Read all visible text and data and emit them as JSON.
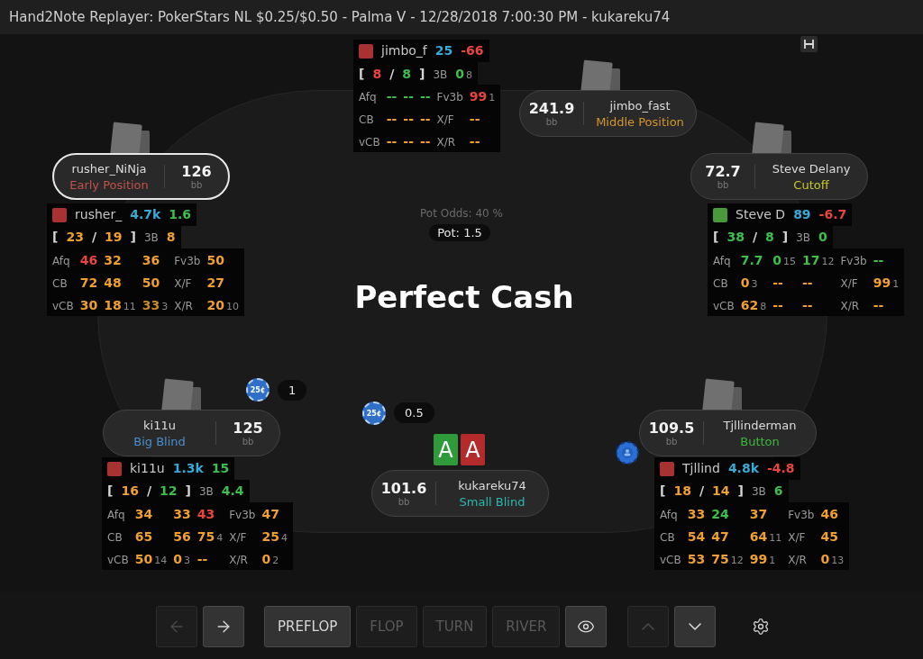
{
  "window": {
    "title": "Hand2Note Replayer: PokerStars NL $0.25/$0.50 - Palma V - 12/28/2018 7:00:30 PM - kukareku74"
  },
  "seats": [
    {
      "name": "jimbo_fast",
      "position": "Middle Position",
      "color": "#d4962c",
      "stack": "241.9",
      "unit": "bb",
      "active": false,
      "dealer": false,
      "hud": {
        "color": "#a83232",
        "header": [
          {
            "text": "jimbo_f",
            "kind": "name"
          },
          {
            "text": "25",
            "kind": "value",
            "color": "#3aa9d6"
          },
          {
            "text": "-66",
            "kind": "value",
            "color": "#e8463c"
          }
        ],
        "preflop": [
          {
            "text": "[",
            "kind": "bracket"
          },
          {
            "text": "8",
            "kind": "value",
            "color": "#e8463c"
          },
          {
            "text": "/",
            "kind": "bracket"
          },
          {
            "text": "8",
            "kind": "value",
            "color": "#3cc04a"
          },
          {
            "text": "]",
            "kind": "bracket"
          },
          {
            "text": "3B",
            "kind": "label"
          },
          {
            "text": "0",
            "kind": "value",
            "color": "#3cc04a",
            "sub": "8"
          }
        ],
        "rows": [
          [
            {
              "text": "Afq",
              "kind": "label"
            },
            {
              "text": "--",
              "kind": "value",
              "color": "#3cc04a"
            },
            {
              "text": "--",
              "kind": "value",
              "color": "#3cc04a"
            },
            {
              "text": "--",
              "kind": "value",
              "color": "#3cc04a"
            },
            {
              "text": "Fv3b",
              "kind": "label"
            },
            {
              "text": "99",
              "kind": "value",
              "color": "#e8463c",
              "sub": "1"
            }
          ],
          [
            {
              "text": "CB",
              "kind": "label"
            },
            {
              "text": "--",
              "kind": "value",
              "color": "#f0a030"
            },
            {
              "text": "--",
              "kind": "value",
              "color": "#f0a030"
            },
            {
              "text": "--",
              "kind": "value",
              "color": "#f0a030"
            },
            {
              "text": "X/F",
              "kind": "label"
            },
            {
              "text": "--",
              "kind": "value",
              "color": "#f0a030"
            }
          ],
          [
            {
              "text": "vCB",
              "kind": "label"
            },
            {
              "text": "--",
              "kind": "value",
              "color": "#f0a030"
            },
            {
              "text": "--",
              "kind": "value",
              "color": "#f0a030"
            },
            {
              "text": "--",
              "kind": "value",
              "color": "#f0a030"
            },
            {
              "text": "X/R",
              "kind": "label"
            },
            {
              "text": "--",
              "kind": "value",
              "color": "#f0a030"
            }
          ]
        ]
      }
    },
    {
      "name": "rusher_NiNja",
      "position": "Early Position",
      "color": "#c0524a",
      "stack": "126",
      "unit": "bb",
      "active": true,
      "dealer": false,
      "hud": {
        "color": "#a83232",
        "header": [
          {
            "text": "rusher_",
            "kind": "name"
          },
          {
            "text": "4.7k",
            "kind": "value",
            "color": "#3aa9d6"
          },
          {
            "text": "1.6",
            "kind": "value",
            "color": "#3cc04a"
          }
        ],
        "preflop": [
          {
            "text": "[",
            "kind": "bracket"
          },
          {
            "text": "23",
            "kind": "value",
            "color": "#f0a030"
          },
          {
            "text": "/",
            "kind": "bracket"
          },
          {
            "text": "19",
            "kind": "value",
            "color": "#f0a030"
          },
          {
            "text": "]",
            "kind": "bracket"
          },
          {
            "text": "3B",
            "kind": "label"
          },
          {
            "text": "8",
            "kind": "value",
            "color": "#f0a030"
          }
        ],
        "rows": [
          [
            {
              "text": "Afq",
              "kind": "label"
            },
            {
              "text": "46",
              "kind": "value",
              "color": "#e8463c"
            },
            {
              "text": "32",
              "kind": "value",
              "color": "#f0a030"
            },
            {
              "text": "36",
              "kind": "value",
              "color": "#f0a030"
            },
            {
              "text": "Fv3b",
              "kind": "label"
            },
            {
              "text": "50",
              "kind": "value",
              "color": "#f0a030"
            }
          ],
          [
            {
              "text": "CB",
              "kind": "label"
            },
            {
              "text": "72",
              "kind": "value",
              "color": "#f0a030"
            },
            {
              "text": "48",
              "kind": "value",
              "color": "#f0a030"
            },
            {
              "text": "50",
              "kind": "value",
              "color": "#f0a030"
            },
            {
              "text": "X/F",
              "kind": "label"
            },
            {
              "text": "27",
              "kind": "value",
              "color": "#f0a030"
            }
          ],
          [
            {
              "text": "vCB",
              "kind": "label"
            },
            {
              "text": "30",
              "kind": "value",
              "color": "#f0a030"
            },
            {
              "text": "18",
              "kind": "value",
              "color": "#f0a030",
              "sub": "11"
            },
            {
              "text": "33",
              "kind": "value",
              "color": "#c88a28",
              "sub": "3"
            },
            {
              "text": "X/R",
              "kind": "label"
            },
            {
              "text": "20",
              "kind": "value",
              "color": "#f0a030",
              "sub": "10"
            }
          ]
        ]
      }
    },
    {
      "name": "Steve Delany",
      "position": "Cutoff",
      "color": "#c8c82c",
      "stack": "72.7",
      "unit": "bb",
      "active": false,
      "dealer": false,
      "hud": {
        "color": "#4a9a3a",
        "header": [
          {
            "text": "Steve D",
            "kind": "name"
          },
          {
            "text": "89",
            "kind": "value",
            "color": "#3aa9d6"
          },
          {
            "text": "-6.7",
            "kind": "value",
            "color": "#e8463c"
          }
        ],
        "preflop": [
          {
            "text": "[",
            "kind": "bracket"
          },
          {
            "text": "38",
            "kind": "value",
            "color": "#3cc04a"
          },
          {
            "text": "/",
            "kind": "bracket"
          },
          {
            "text": "8",
            "kind": "value",
            "color": "#3cc04a"
          },
          {
            "text": "]",
            "kind": "bracket"
          },
          {
            "text": "3B",
            "kind": "label"
          },
          {
            "text": "0",
            "kind": "value",
            "color": "#3cc04a"
          }
        ],
        "rows": [
          [
            {
              "text": "Afq",
              "kind": "label"
            },
            {
              "text": "7.7",
              "kind": "value",
              "color": "#3cc04a"
            },
            {
              "text": "0",
              "kind": "value",
              "color": "#3cc04a",
              "sub": "15"
            },
            {
              "text": "17",
              "kind": "value",
              "color": "#3cc04a",
              "sub": "12"
            },
            {
              "text": "Fv3b",
              "kind": "label"
            },
            {
              "text": "--",
              "kind": "value",
              "color": "#3cc04a"
            }
          ],
          [
            {
              "text": "CB",
              "kind": "label"
            },
            {
              "text": "0",
              "kind": "value",
              "color": "#f0a030",
              "sub": "3"
            },
            {
              "text": "--",
              "kind": "value",
              "color": "#f0a030"
            },
            {
              "text": "--",
              "kind": "value",
              "color": "#f0a030"
            },
            {
              "text": "X/F",
              "kind": "label"
            },
            {
              "text": "99",
              "kind": "value",
              "color": "#f0a030",
              "sub": "1"
            }
          ],
          [
            {
              "text": "vCB",
              "kind": "label"
            },
            {
              "text": "62",
              "kind": "value",
              "color": "#f0a030",
              "sub": "8"
            },
            {
              "text": "--",
              "kind": "value",
              "color": "#f0a030"
            },
            {
              "text": "--",
              "kind": "value",
              "color": "#f0a030"
            },
            {
              "text": "X/R",
              "kind": "label"
            },
            {
              "text": "--",
              "kind": "value",
              "color": "#f0a030"
            }
          ]
        ]
      }
    },
    {
      "name": "ki11u",
      "position": "Big Blind",
      "color": "#4a8fd0",
      "stack": "125",
      "unit": "bb",
      "active": false,
      "dealer": false,
      "bet": {
        "chip": "25¢",
        "amount": "1"
      },
      "hud": {
        "color": "#a83232",
        "header": [
          {
            "text": "ki11u",
            "kind": "name"
          },
          {
            "text": "1.3k",
            "kind": "value",
            "color": "#3aa9d6"
          },
          {
            "text": "15",
            "kind": "value",
            "color": "#3cc04a"
          }
        ],
        "preflop": [
          {
            "text": "[",
            "kind": "bracket"
          },
          {
            "text": "16",
            "kind": "value",
            "color": "#f0a030"
          },
          {
            "text": "/",
            "kind": "bracket"
          },
          {
            "text": "12",
            "kind": "value",
            "color": "#3cc04a"
          },
          {
            "text": "]",
            "kind": "bracket"
          },
          {
            "text": "3B",
            "kind": "label"
          },
          {
            "text": "4.4",
            "kind": "value",
            "color": "#3cc04a"
          }
        ],
        "rows": [
          [
            {
              "text": "Afq",
              "kind": "label"
            },
            {
              "text": "34",
              "kind": "value",
              "color": "#f0a030"
            },
            {
              "text": "33",
              "kind": "value",
              "color": "#f0a030"
            },
            {
              "text": "43",
              "kind": "value",
              "color": "#e8463c"
            },
            {
              "text": "Fv3b",
              "kind": "label"
            },
            {
              "text": "47",
              "kind": "value",
              "color": "#f0a030"
            }
          ],
          [
            {
              "text": "CB",
              "kind": "label"
            },
            {
              "text": "65",
              "kind": "value",
              "color": "#f0a030"
            },
            {
              "text": "56",
              "kind": "value",
              "color": "#f0a030"
            },
            {
              "text": "75",
              "kind": "value",
              "color": "#f0a030",
              "sub": "4"
            },
            {
              "text": "X/F",
              "kind": "label"
            },
            {
              "text": "25",
              "kind": "value",
              "color": "#f0a030",
              "sub": "4"
            }
          ],
          [
            {
              "text": "vCB",
              "kind": "label"
            },
            {
              "text": "50",
              "kind": "value",
              "color": "#f0a030",
              "sub": "14"
            },
            {
              "text": "0",
              "kind": "value",
              "color": "#f0a030",
              "sub": "3"
            },
            {
              "text": "--",
              "kind": "value",
              "color": "#f0a030"
            },
            {
              "text": "X/R",
              "kind": "label"
            },
            {
              "text": "0",
              "kind": "value",
              "color": "#f0a030",
              "sub": "2"
            }
          ]
        ]
      }
    },
    {
      "name": "Tjllinderman",
      "position": "Button",
      "color": "#3cb83c",
      "stack": "109.5",
      "unit": "bb",
      "active": false,
      "dealer": true,
      "hud": {
        "color": "#a83232",
        "header": [
          {
            "text": "Tjllind",
            "kind": "name"
          },
          {
            "text": "4.8k",
            "kind": "value",
            "color": "#3aa9d6"
          },
          {
            "text": "-4.8",
            "kind": "value",
            "color": "#e8463c"
          }
        ],
        "preflop": [
          {
            "text": "[",
            "kind": "bracket"
          },
          {
            "text": "18",
            "kind": "value",
            "color": "#f0a030"
          },
          {
            "text": "/",
            "kind": "bracket"
          },
          {
            "text": "14",
            "kind": "value",
            "color": "#f0a030"
          },
          {
            "text": "]",
            "kind": "bracket"
          },
          {
            "text": "3B",
            "kind": "label"
          },
          {
            "text": "6",
            "kind": "value",
            "color": "#3cc04a"
          }
        ],
        "rows": [
          [
            {
              "text": "Afq",
              "kind": "label"
            },
            {
              "text": "33",
              "kind": "value",
              "color": "#f0a030"
            },
            {
              "text": "24",
              "kind": "value",
              "color": "#3cc04a"
            },
            {
              "text": "37",
              "kind": "value",
              "color": "#f0a030"
            },
            {
              "text": "Fv3b",
              "kind": "label"
            },
            {
              "text": "46",
              "kind": "value",
              "color": "#f0a030"
            }
          ],
          [
            {
              "text": "CB",
              "kind": "label"
            },
            {
              "text": "54",
              "kind": "value",
              "color": "#f0a030"
            },
            {
              "text": "47",
              "kind": "value",
              "color": "#f0a030"
            },
            {
              "text": "64",
              "kind": "value",
              "color": "#f0a030",
              "sub": "11"
            },
            {
              "text": "X/F",
              "kind": "label"
            },
            {
              "text": "45",
              "kind": "value",
              "color": "#f0a030"
            }
          ],
          [
            {
              "text": "vCB",
              "kind": "label"
            },
            {
              "text": "53",
              "kind": "value",
              "color": "#f0a030"
            },
            {
              "text": "75",
              "kind": "value",
              "color": "#f0a030",
              "sub": "12"
            },
            {
              "text": "99",
              "kind": "value",
              "color": "#f0a030",
              "sub": "1"
            },
            {
              "text": "X/R",
              "kind": "label"
            },
            {
              "text": "0",
              "kind": "value",
              "color": "#f0a030",
              "sub": "13"
            }
          ]
        ]
      }
    },
    {
      "name": "kukareku74",
      "position": "Small Blind",
      "color": "#2ab8b0",
      "stack": "101.6",
      "unit": "bb",
      "active": false,
      "dealer": false,
      "bet": {
        "chip": "25¢",
        "amount": "0.5"
      },
      "hole_cards": [
        {
          "rank": "A",
          "color": "#2f9a3a"
        },
        {
          "rank": "A",
          "color": "#b52a2a"
        }
      ]
    }
  ],
  "table": {
    "pot_odds": "Pot Odds: 40 %",
    "pot": "Pot: 1.5",
    "title": "Perfect Cash"
  },
  "toolbar": [
    {
      "kind": "back",
      "disabled": true
    },
    {
      "kind": "forward",
      "disabled": false
    },
    {
      "kind": "street",
      "label": "PREFLOP",
      "selected": true
    },
    {
      "kind": "street",
      "label": "FLOP",
      "selected": false
    },
    {
      "kind": "street",
      "label": "TURN",
      "selected": false
    },
    {
      "kind": "street",
      "label": "RIVER",
      "selected": false
    },
    {
      "kind": "eye",
      "disabled": false
    },
    {
      "kind": "up",
      "disabled": true
    },
    {
      "kind": "down",
      "disabled": false
    },
    {
      "kind": "settings"
    }
  ]
}
